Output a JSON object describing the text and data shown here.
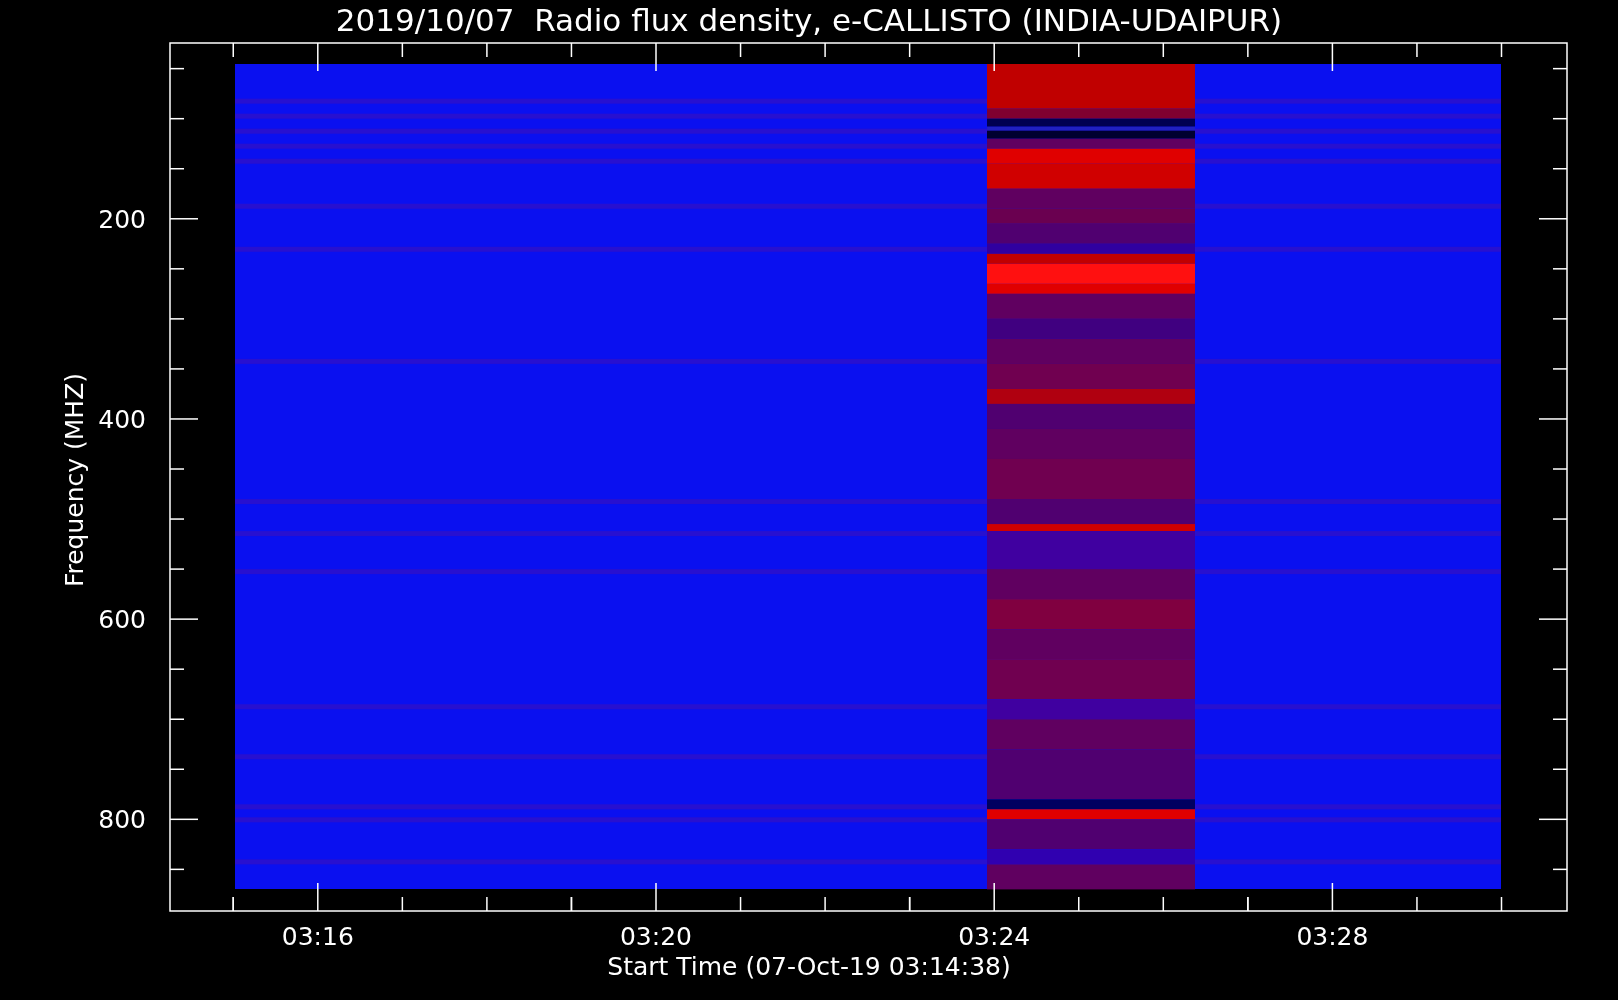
{
  "title": "2019/10/07  Radio flux density, e-CALLISTO (INDIA-UDAIPUR)",
  "y_axis": {
    "label": "Frequency (MHZ)",
    "tick_labels": [
      "200",
      "400",
      "600",
      "800"
    ]
  },
  "x_axis": {
    "label": "Start Time (07-Oct-19 03:14:38)",
    "tick_labels": [
      "03:16",
      "03:20",
      "03:24",
      "03:28"
    ]
  }
}
